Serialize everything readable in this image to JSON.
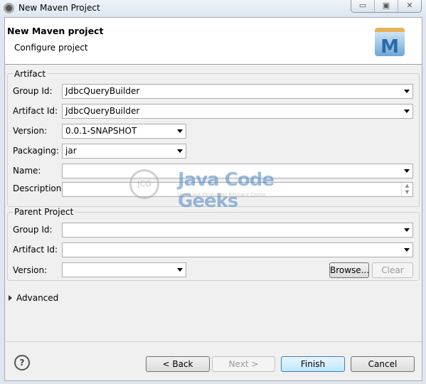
{
  "window": {
    "title": "New Maven Project",
    "controls": [
      "▭",
      "▣",
      "✕"
    ]
  },
  "header": {
    "title": "New Maven project",
    "subtitle": "Configure project",
    "logo_letter": "M"
  },
  "artifact": {
    "group_label": "Artifact",
    "group_id": {
      "label": "Group Id:",
      "value": "JdbcQueryBuilder"
    },
    "artifact_id": {
      "label": "Artifact Id:",
      "value": "JdbcQueryBuilder"
    },
    "version": {
      "label": "Version:",
      "value": "0.0.1-SNAPSHOT"
    },
    "packaging": {
      "label": "Packaging:",
      "value": "jar"
    },
    "name": {
      "label": "Name:",
      "value": ""
    },
    "description": {
      "label": "Description:",
      "value": ""
    }
  },
  "parent": {
    "group_label": "Parent Project",
    "group_id": {
      "label": "Group Id:",
      "value": ""
    },
    "artifact_id": {
      "label": "Artifact Id:",
      "value": ""
    },
    "version": {
      "label": "Version:",
      "value": ""
    },
    "browse": "Browse...",
    "clear": "Clear"
  },
  "advanced": "Advanced",
  "watermark": {
    "text": "Java Code Geeks",
    "tagline": "Java 2 Java Developers Resource Center",
    "logo": "JCG"
  },
  "buttons": {
    "help": "?",
    "back": "< Back",
    "next": "Next >",
    "finish": "Finish",
    "cancel": "Cancel"
  }
}
